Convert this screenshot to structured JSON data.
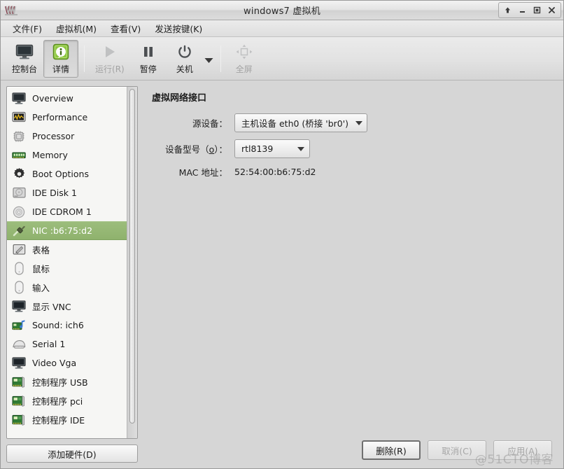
{
  "window": {
    "title": "windows7 虚拟机",
    "app_icon": "vm-logo-icon",
    "controls": [
      {
        "name": "shade-button",
        "glyph": "up-arrow-icon"
      },
      {
        "name": "minimize-button",
        "glyph": "minimize-icon"
      },
      {
        "name": "maximize-button",
        "glyph": "maximize-icon"
      },
      {
        "name": "close-button",
        "glyph": "close-icon"
      }
    ]
  },
  "menubar": [
    {
      "label": "文件(F)",
      "accel": "F"
    },
    {
      "label": "虚拟机(M)",
      "accel": "M"
    },
    {
      "label": "查看(V)",
      "accel": "V"
    },
    {
      "label": "发送按键(K)",
      "accel": "K"
    }
  ],
  "toolbar": {
    "console_label": "控制台",
    "details_label": "详情",
    "run_label": "运行(R)",
    "pause_label": "暂停",
    "shutdown_label": "关机",
    "fullscreen_label": "全屏"
  },
  "sidebar": {
    "add_hardware_label": "添加硬件(D)",
    "items": [
      {
        "label": "Overview",
        "icon": "monitor-icon"
      },
      {
        "label": "Performance",
        "icon": "performance-graph-icon"
      },
      {
        "label": "Processor",
        "icon": "cpu-chip-icon"
      },
      {
        "label": "Memory",
        "icon": "memory-module-icon"
      },
      {
        "label": "Boot Options",
        "icon": "gear-icon"
      },
      {
        "label": "IDE Disk 1",
        "icon": "hard-disk-icon"
      },
      {
        "label": "IDE CDROM 1",
        "icon": "cdrom-disc-icon"
      },
      {
        "label": "NIC :b6:75:d2",
        "icon": "network-plug-icon",
        "selected": true
      },
      {
        "label": "表格",
        "icon": "tablet-pen-icon"
      },
      {
        "label": "鼠标",
        "icon": "mouse-icon"
      },
      {
        "label": "输入",
        "icon": "mouse-icon"
      },
      {
        "label": "显示 VNC",
        "icon": "monitor-icon"
      },
      {
        "label": "Sound: ich6",
        "icon": "sound-card-icon"
      },
      {
        "label": "Serial 1",
        "icon": "serial-port-icon"
      },
      {
        "label": "Video Vga",
        "icon": "monitor-icon"
      },
      {
        "label": "控制程序 USB",
        "icon": "controller-card-icon"
      },
      {
        "label": "控制程序 pci",
        "icon": "controller-card-icon"
      },
      {
        "label": "控制程序 IDE",
        "icon": "controller-card-icon"
      }
    ]
  },
  "main": {
    "heading": "虚拟网络接口",
    "source_device_label": "源设备：",
    "source_device_value": "主机设备 eth0 (桥接 'br0')",
    "device_model_label_pre": "设备型号（",
    "device_model_label_accel": "o",
    "device_model_label_post": "）：",
    "device_model_value": "rtl8139",
    "mac_label": "MAC 地址：",
    "mac_value": "52:54:00:b6:75:d2"
  },
  "footer": {
    "remove_label": "删除(R)",
    "cancel_label": "取消(C)",
    "apply_label": "应用(A)",
    "watermark": "@51CTO博客"
  },
  "colors": {
    "selection_green": "#8fb26d",
    "window_bg": "#d6d6d6",
    "list_bg": "#f6f6f4"
  }
}
